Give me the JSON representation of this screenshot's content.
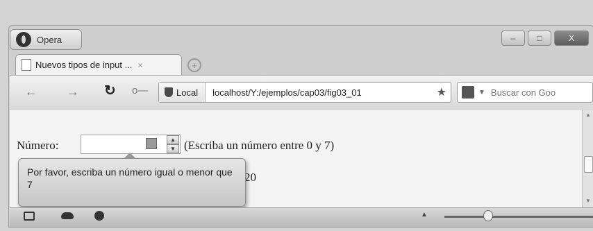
{
  "browser": {
    "app_button_label": "Opera",
    "tab": {
      "title": "Nuevos tipos de input ...",
      "close": "×"
    },
    "new_tab": "+",
    "toolbar": {
      "back": "←",
      "forward": "→",
      "reload": "↻",
      "key": "o—",
      "security_label": "Local",
      "url": "localhost/Y:/ejemplos/cap03/fig03_01",
      "bookmark": "★",
      "search_placeholder": "Buscar con Goo",
      "search_dropdown": "▼"
    },
    "window_controls": {
      "minimize": "–",
      "maximize": "□",
      "close": "X"
    }
  },
  "page": {
    "field_label": "Número:",
    "field_value": "",
    "hint": "(Escriba un número entre 0 y 7)",
    "entered_value": "20",
    "validation_tooltip": "Por favor, escriba un número igual o menor que 7",
    "spinner_up": "▲",
    "spinner_down": "▼"
  },
  "statusbar": {
    "icons": [
      "panel-icon",
      "cloud-icon",
      "speed-dial-icon"
    ],
    "up_arrow": "▲",
    "zoom_level_fraction": 0.27
  },
  "colors": {
    "tooltip_bg": "#d6d6d6",
    "page_bg": "#f4f4f4"
  }
}
